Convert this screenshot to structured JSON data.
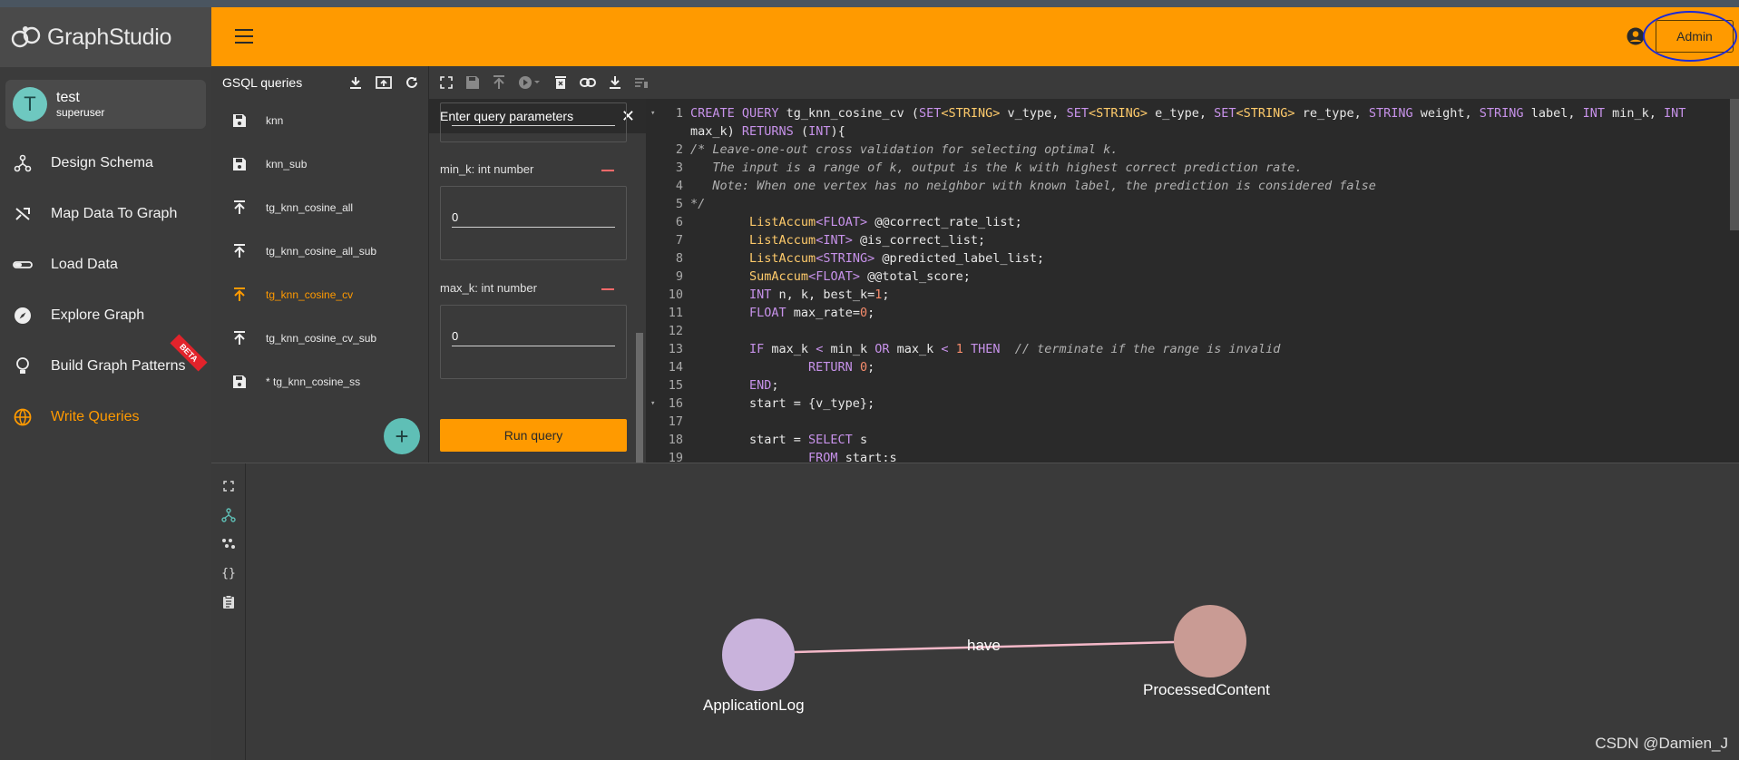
{
  "app": {
    "logo_text": "GraphStudio"
  },
  "user": {
    "initial": "T",
    "name": "test",
    "role": "superuser"
  },
  "sidebar": {
    "items": [
      {
        "label": "Design Schema",
        "icon": "schema-icon"
      },
      {
        "label": "Map Data To Graph",
        "icon": "shuffle-icon"
      },
      {
        "label": "Load Data",
        "icon": "load-icon"
      },
      {
        "label": "Explore Graph",
        "icon": "compass-icon"
      },
      {
        "label": "Build Graph Patterns",
        "icon": "bulb-icon",
        "badge": "BETA"
      },
      {
        "label": "Write Queries",
        "icon": "globe-icon",
        "active": true
      }
    ]
  },
  "header": {
    "admin_label": "Admin"
  },
  "queries": {
    "title": "GSQL queries",
    "items": [
      {
        "label": "knn",
        "icon": "save-icon"
      },
      {
        "label": "knn_sub",
        "icon": "save-icon"
      },
      {
        "label": "tg_knn_cosine_all",
        "icon": "install-icon"
      },
      {
        "label": "tg_knn_cosine_all_sub",
        "icon": "install-icon"
      },
      {
        "label": "tg_knn_cosine_cv",
        "icon": "install-icon",
        "active": true
      },
      {
        "label": "tg_knn_cosine_cv_sub",
        "icon": "install-icon"
      },
      {
        "label": "* tg_knn_cosine_ss",
        "icon": "save-icon"
      }
    ],
    "add_label": "+"
  },
  "params": {
    "title": "Enter query parameters",
    "close": "✕",
    "fields": [
      {
        "label": "min_k: int number",
        "value": "0"
      },
      {
        "label": "max_k: int number",
        "value": "0"
      }
    ],
    "run_label": "Run query"
  },
  "code": {
    "lines": [
      {
        "n": "1",
        "fold": "▾",
        "html": "<span class=\"kw\">CREATE QUERY</span> tg_knn_cosine_cv (<span class=\"kw\">SET</span><span class=\"ty\">&lt;STRING&gt;</span> v_type, <span class=\"kw\">SET</span><span class=\"ty\">&lt;STRING&gt;</span> e_type, <span class=\"kw\">SET</span><span class=\"ty\">&lt;STRING&gt;</span> re_type, <span class=\"kw\">STRING</span> weight, <span class=\"kw\">STRING</span> label, <span class=\"kw\">INT</span> min_k, <span class=\"kw\">INT</span>"
      },
      {
        "n": "",
        "fold": "",
        "html": "max_k) <span class=\"kw\">RETURNS</span> (<span class=\"kw\">INT</span>){"
      },
      {
        "n": "2",
        "fold": "",
        "html": "<span class=\"cm\">/* Leave-one-out cross validation for selecting optimal k.</span>"
      },
      {
        "n": "3",
        "fold": "",
        "html": "<span class=\"cm\">   The input is a range of k, output is the k with highest correct prediction rate.</span>"
      },
      {
        "n": "4",
        "fold": "",
        "html": "<span class=\"cm\">   Note: When one vertex has no neighbor with known label, the prediction is considered false</span>"
      },
      {
        "n": "5",
        "fold": "",
        "html": "<span class=\"cm\">*/</span>"
      },
      {
        "n": "6",
        "fold": "",
        "html": "        <span class=\"ty\">ListAccum</span><span class=\"kw\">&lt;FLOAT&gt;</span> @@correct_rate_list;"
      },
      {
        "n": "7",
        "fold": "",
        "html": "        <span class=\"ty\">ListAccum</span><span class=\"kw\">&lt;INT&gt;</span> @is_correct_list;"
      },
      {
        "n": "8",
        "fold": "",
        "html": "        <span class=\"ty\">ListAccum</span><span class=\"kw\">&lt;STRING&gt;</span> @predicted_label_list;"
      },
      {
        "n": "9",
        "fold": "",
        "html": "        <span class=\"ty\">SumAccum</span><span class=\"kw\">&lt;FLOAT&gt;</span> @@total_score;"
      },
      {
        "n": "10",
        "fold": "",
        "html": "        <span class=\"kw\">INT</span> n, k, best_k=<span class=\"nm\">1</span>;"
      },
      {
        "n": "11",
        "fold": "",
        "html": "        <span class=\"kw\">FLOAT</span> max_rate=<span class=\"nm\">0</span>;"
      },
      {
        "n": "12",
        "fold": "",
        "html": ""
      },
      {
        "n": "13",
        "fold": "",
        "html": "        <span class=\"kw\">IF</span> max_k <span class=\"kw\">&lt;</span> min_k <span class=\"kw\">OR</span> max_k <span class=\"kw\">&lt;</span> <span class=\"nm\">1</span> <span class=\"kw\">THEN</span>  <span class=\"cm\">// terminate if the range is invalid</span>"
      },
      {
        "n": "14",
        "fold": "",
        "html": "                <span class=\"kw\">RETURN</span> <span class=\"nm\">0</span>;"
      },
      {
        "n": "15",
        "fold": "",
        "html": "        <span class=\"kw\">END</span>;"
      },
      {
        "n": "16",
        "fold": "▾",
        "html": "        start = {v_type};"
      },
      {
        "n": "17",
        "fold": "",
        "html": ""
      },
      {
        "n": "18",
        "fold": "",
        "html": "        start = <span class=\"kw\">SELECT</span> s"
      },
      {
        "n": "19",
        "fold": "",
        "html": "                <span class=\"kw\">FROM</span> start:s"
      }
    ]
  },
  "graph": {
    "nodes": [
      {
        "label": "ApplicationLog",
        "color": "#c9b3dc"
      },
      {
        "label": "ProcessedContent",
        "color": "#c99b94"
      }
    ],
    "edge": {
      "label": "have",
      "color": "#f4b8c8"
    }
  },
  "watermark": "CSDN @Damien_J"
}
